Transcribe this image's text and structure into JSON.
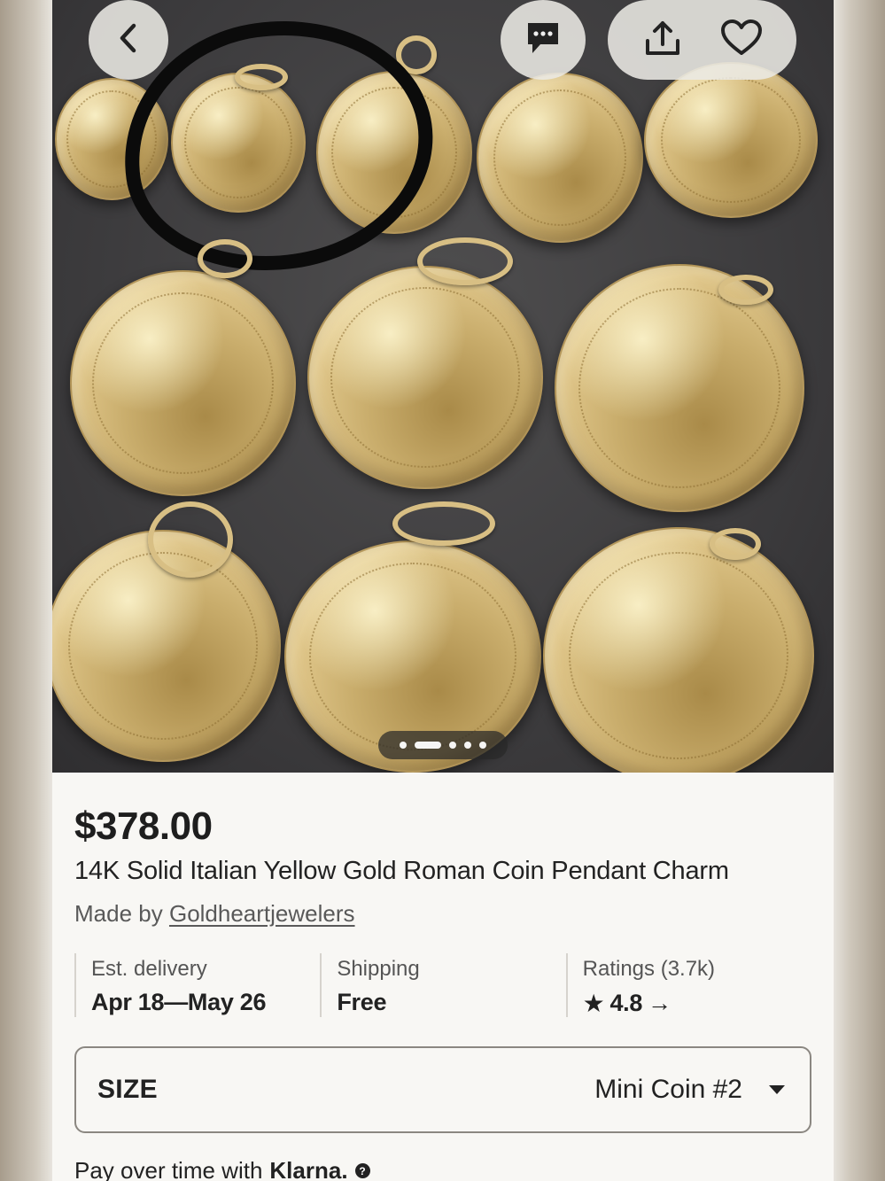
{
  "listing": {
    "price": "$378.00",
    "title": "14K Solid Italian Yellow Gold Roman Coin Pendant Charm",
    "maker_prefix": "Made by",
    "shop_name": "Goldheartjewelers"
  },
  "hero": {
    "image_count": 5,
    "active_image_index": 1,
    "buttons": [
      "back-icon",
      "message-icon",
      "share-icon",
      "heart-icon"
    ]
  },
  "info": {
    "delivery_label": "Est. delivery",
    "delivery_value": "Apr 18—May 26",
    "shipping_label": "Shipping",
    "shipping_value": "Free",
    "ratings_label": "Ratings (3.7k)",
    "ratings_value": "4.8",
    "ratings_arrow": "→",
    "star": "★"
  },
  "size_select": {
    "label": "SIZE",
    "value": "Mini Coin #2"
  },
  "klarna": {
    "text": "Pay over time with",
    "brand": "Klarna."
  },
  "colors": {
    "accent": "#222222",
    "background": "#f8f7f4",
    "hero_background": "#3a393b",
    "gold": "#d8bf84"
  }
}
